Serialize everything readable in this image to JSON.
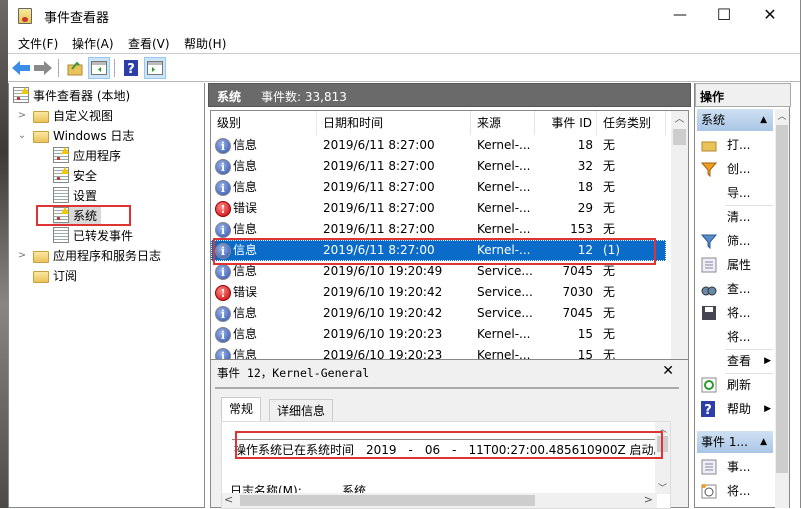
{
  "window": {
    "title": "事件查看器",
    "controls": {
      "minimize": "—",
      "maximize": "☐",
      "close": "✕"
    }
  },
  "menu": [
    "文件(F)",
    "操作(A)",
    "查看(V)",
    "帮助(H)"
  ],
  "toolbar": {
    "buttons": [
      "back-icon",
      "forward-icon",
      "up-folder-icon",
      "show-hide-tree-icon",
      "help-icon",
      "show-hide-action-pane-icon"
    ]
  },
  "tree": {
    "root": "事件查看器 (本地)",
    "items": [
      {
        "label": "自定义视图",
        "expander": ">"
      },
      {
        "label": "Windows 日志",
        "expander": "⌄"
      },
      {
        "label": "应用程序"
      },
      {
        "label": "安全"
      },
      {
        "label": "设置"
      },
      {
        "label": "系统",
        "selected": true
      },
      {
        "label": "已转发事件"
      },
      {
        "label": "应用程序和服务日志",
        "expander": ">"
      },
      {
        "label": "订阅"
      }
    ]
  },
  "log_header": {
    "name": "系统",
    "count_label": "事件数: 33,813"
  },
  "columns": [
    "级别",
    "日期和时间",
    "来源",
    "事件 ID",
    "任务类别"
  ],
  "rows": [
    {
      "level": "信息",
      "type": "info",
      "datetime": "2019/6/11 8:27:00",
      "source": "Kernel-...",
      "id": "18",
      "task": "无"
    },
    {
      "level": "信息",
      "type": "info",
      "datetime": "2019/6/11 8:27:00",
      "source": "Kernel-...",
      "id": "32",
      "task": "无"
    },
    {
      "level": "信息",
      "type": "info",
      "datetime": "2019/6/11 8:27:00",
      "source": "Kernel-...",
      "id": "18",
      "task": "无"
    },
    {
      "level": "错误",
      "type": "err",
      "datetime": "2019/6/11 8:27:00",
      "source": "Kernel-...",
      "id": "29",
      "task": "无"
    },
    {
      "level": "信息",
      "type": "info",
      "datetime": "2019/6/11 8:27:00",
      "source": "Kernel-...",
      "id": "153",
      "task": "无"
    },
    {
      "level": "信息",
      "type": "info",
      "datetime": "2019/6/11 8:27:00",
      "source": "Kernel-...",
      "id": "12",
      "task": "(1)",
      "selected": true
    },
    {
      "level": "信息",
      "type": "info",
      "datetime": "2019/6/10 19:20:49",
      "source": "Service...",
      "id": "7045",
      "task": "无"
    },
    {
      "level": "错误",
      "type": "err",
      "datetime": "2019/6/10 19:20:42",
      "source": "Service...",
      "id": "7030",
      "task": "无"
    },
    {
      "level": "信息",
      "type": "info",
      "datetime": "2019/6/10 19:20:42",
      "source": "Service...",
      "id": "7045",
      "task": "无"
    },
    {
      "level": "信息",
      "type": "info",
      "datetime": "2019/6/10 19:20:23",
      "source": "Kernel-...",
      "id": "15",
      "task": "无"
    },
    {
      "level": "信息",
      "type": "info",
      "datetime": "2019/6/10 19:20:23",
      "source": "Kernel-...",
      "id": "15",
      "task": "无"
    }
  ],
  "detail": {
    "title": "事件 12，Kernel-General",
    "close": "✕",
    "tabs": [
      "常规",
      "详细信息"
    ],
    "message": "操作系统已在系统时间　2019　-　06　-　11T00:27:00.485610900Z 启动。",
    "log_name_label": "日志名称(M):",
    "log_name_value": "系统"
  },
  "actions": {
    "header": "操作",
    "section1": "系统",
    "items1": [
      {
        "label": "打...",
        "icon": "open-folder-icon"
      },
      {
        "label": "创...",
        "icon": "create-filter-icon"
      },
      {
        "label": "导...",
        "icon": ""
      },
      {
        "label": "清...",
        "icon": ""
      },
      {
        "label": "筛...",
        "icon": "filter-icon"
      },
      {
        "label": "属性",
        "icon": "properties-icon"
      },
      {
        "label": "查...",
        "icon": "find-icon"
      },
      {
        "label": "将...",
        "icon": "save-icon"
      },
      {
        "label": "将...",
        "icon": ""
      },
      {
        "label": "查看",
        "icon": "",
        "submenu": "▶"
      },
      {
        "label": "刷新",
        "icon": "refresh-icon"
      },
      {
        "label": "帮助",
        "icon": "help-icon",
        "submenu": "▶"
      }
    ],
    "section2": "事件 1...",
    "items2": [
      {
        "label": "事...",
        "icon": "event-properties-icon"
      },
      {
        "label": "将...",
        "icon": "attach-task-icon"
      }
    ]
  }
}
